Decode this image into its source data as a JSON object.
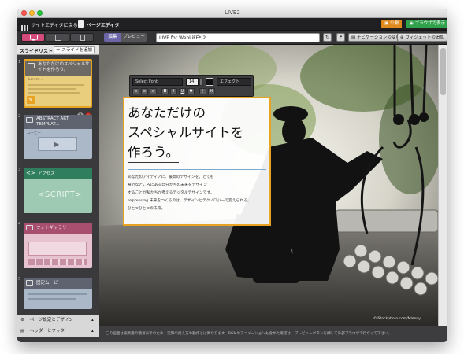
{
  "window": {
    "title": "LIVE2"
  },
  "topbar": {
    "back_label": "サイトエディタに戻る",
    "page_editor_label": "ページエディタ",
    "publish_label": "公開",
    "browser_label": "ブラウザで表示"
  },
  "toolbar2": {
    "edit_label": "編集",
    "preview_label": "プレビュー",
    "page_title": "LIVE for WebLiFE* 2",
    "nav_change_label": "ナビゲーションの変更",
    "add_widget_label": "ウィジェットの追加",
    "f_label": "F"
  },
  "sidebar": {
    "tab_label": "スライドリスト",
    "add_slide_label": "スライドを追加",
    "slides": [
      {
        "num": "1",
        "title": "あなただけのスペシャルサイトを作ろう。",
        "caption": "Lorem..."
      },
      {
        "num": "2",
        "title": "ABSTRACT ART TEMPLAT...",
        "caption": "ムービー"
      },
      {
        "num": "3",
        "title": "アクセス",
        "caption": "<SCRIPT>"
      },
      {
        "num": "4",
        "title": "フォトギャラリー",
        "caption": ""
      },
      {
        "num": "5",
        "title": "固定ムービー",
        "caption": ""
      }
    ],
    "panels": [
      "ページ設定とデザイン",
      "ヘッダーとフッター"
    ]
  },
  "text_toolbar": {
    "font_select": "Select Font",
    "font_size": "14",
    "effect_label": "エフェクト"
  },
  "canvas": {
    "headline_lines": [
      "あなただけの",
      "スペシャルサイトを",
      "作ろう。"
    ],
    "body_lines": [
      "あなたのアイディアに、最高のデザインを。とても",
      "身近なところにある自分たちの未来をデザイン",
      "することが私たちが考えるデジタルデザインです。",
      "expressing 未来をつくるのは、デザインとテクノロジーで変えられる。",
      "ひとつひとつの未来。"
    ],
    "credit": "©iStockphoto.com/Mlenny",
    "footer_note": "この画面は編集用の簡易表示のため、実際の見え方や動作とは異なります。BGMやアニメーションも含めた確認は、プレビューボタンを押して外部ブラウザで行なって下さい。"
  },
  "colors": {
    "accent_orange": "#e7a321",
    "publish_orange": "#e08a1e",
    "browser_green": "#2fa24b",
    "delete_red": "#d9412e"
  }
}
